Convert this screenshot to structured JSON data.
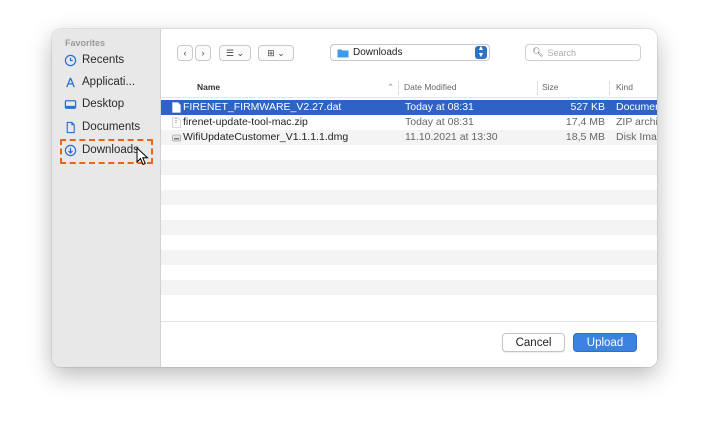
{
  "sidebar": {
    "section_title": "Favorites",
    "items": [
      {
        "label": "Recents",
        "icon": "clock-icon"
      },
      {
        "label": "Applicati...",
        "icon": "applications-icon"
      },
      {
        "label": "Desktop",
        "icon": "desktop-icon"
      },
      {
        "label": "Documents",
        "icon": "document-icon"
      },
      {
        "label": "Downloads",
        "icon": "download-icon",
        "highlighted": true
      }
    ]
  },
  "toolbar": {
    "back_icon": "chevron-left-icon",
    "forward_icon": "chevron-right-icon",
    "list_view_icon": "list-view-icon",
    "grid_view_icon": "grid-view-icon",
    "location": "Downloads",
    "search_placeholder": "Search"
  },
  "columns": {
    "name": "Name",
    "date": "Date Modified",
    "size": "Size",
    "kind": "Kind"
  },
  "files": [
    {
      "name": "FIRENET_FIRMWARE_V2.27.dat",
      "date": "Today at 08:31",
      "size": "527 KB",
      "kind": "Document",
      "selected": true
    },
    {
      "name": "firenet-update-tool-mac.zip",
      "date": "Today at 08:31",
      "size": "17,4 MB",
      "kind": "ZIP archive",
      "selected": false
    },
    {
      "name": "WifiUpdateCustomer_V1.1.1.1.dmg",
      "date": "11.10.2021 at 13:30",
      "size": "18,5 MB",
      "kind": "Disk Image",
      "selected": false
    }
  ],
  "buttons": {
    "cancel": "Cancel",
    "upload": "Upload"
  },
  "colors": {
    "selection": "#2d63c4",
    "primary_button": "#3c82e0",
    "highlight_border": "#e8661a"
  }
}
